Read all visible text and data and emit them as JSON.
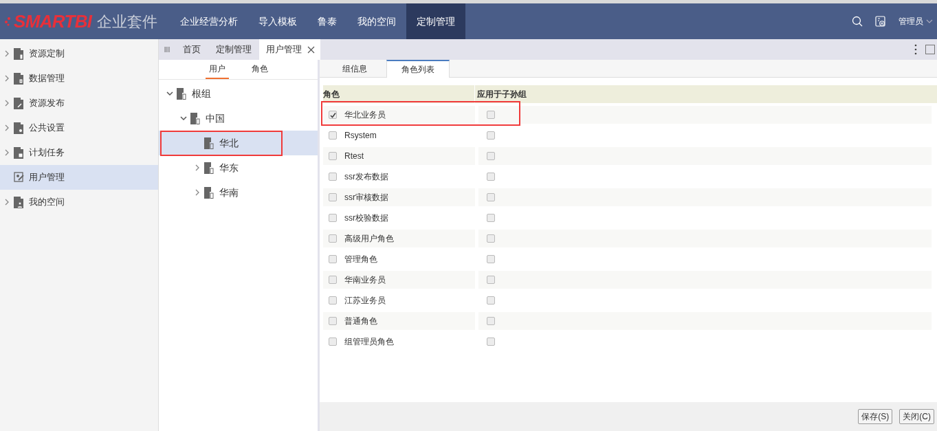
{
  "header": {
    "logo": "SMARTBI",
    "product": "企业套件",
    "nav": [
      {
        "label": "企业经营分析",
        "selected": false
      },
      {
        "label": "导入模板",
        "selected": false
      },
      {
        "label": "鲁泰",
        "selected": false
      },
      {
        "label": "我的空间",
        "selected": false
      },
      {
        "label": "定制管理",
        "selected": true
      }
    ],
    "user": "管理员"
  },
  "sidebar": {
    "items": [
      {
        "label": "资源定制",
        "selected": false,
        "expandable": true
      },
      {
        "label": "数据管理",
        "selected": false,
        "expandable": true
      },
      {
        "label": "资源发布",
        "selected": false,
        "expandable": true
      },
      {
        "label": "公共设置",
        "selected": false,
        "expandable": true
      },
      {
        "label": "计划任务",
        "selected": false,
        "expandable": true
      },
      {
        "label": "用户管理",
        "selected": true,
        "expandable": false
      },
      {
        "label": "我的空间",
        "selected": false,
        "expandable": true
      }
    ]
  },
  "tab_bar_handle": "III",
  "tabs": [
    {
      "label": "首页",
      "selected": false,
      "closable": false
    },
    {
      "label": "定制管理",
      "selected": false,
      "closable": false
    },
    {
      "label": "用户管理",
      "selected": true,
      "closable": true
    }
  ],
  "tree_tabs": [
    {
      "label": "用户",
      "selected": true
    },
    {
      "label": "角色",
      "selected": false
    }
  ],
  "tree": [
    {
      "label": "根组",
      "expanded": true,
      "selected": false,
      "highlighted": false,
      "children": [
        {
          "label": "中国",
          "expanded": true,
          "selected": false,
          "highlighted": false,
          "children": [
            {
              "label": "华北",
              "selected": true,
              "highlighted": true
            },
            {
              "label": "华东",
              "expanded": false,
              "selected": false,
              "highlighted": false
            },
            {
              "label": "华南",
              "expanded": false,
              "selected": false,
              "highlighted": false
            }
          ]
        }
      ]
    }
  ],
  "detail_tabs": [
    {
      "label": "组信息",
      "selected": false
    },
    {
      "label": "角色列表",
      "selected": true
    }
  ],
  "table": {
    "columns": [
      "角色",
      "应用于子孙组"
    ],
    "rows": [
      {
        "role": "华北业务员",
        "checked": true,
        "apply_to_descendants": false,
        "highlighted": true
      },
      {
        "role": "Rsystem",
        "checked": false,
        "apply_to_descendants": false,
        "highlighted": false
      },
      {
        "role": "Rtest",
        "checked": false,
        "apply_to_descendants": false,
        "highlighted": false
      },
      {
        "role": "ssr发布数据",
        "checked": false,
        "apply_to_descendants": false,
        "highlighted": false
      },
      {
        "role": "ssr审核数据",
        "checked": false,
        "apply_to_descendants": false,
        "highlighted": false
      },
      {
        "role": "ssr校验数据",
        "checked": false,
        "apply_to_descendants": false,
        "highlighted": false
      },
      {
        "role": "高级用户角色",
        "checked": false,
        "apply_to_descendants": false,
        "highlighted": false
      },
      {
        "role": "管理角色",
        "checked": false,
        "apply_to_descendants": false,
        "highlighted": false
      },
      {
        "role": "华南业务员",
        "checked": false,
        "apply_to_descendants": false,
        "highlighted": false
      },
      {
        "role": "江苏业务员",
        "checked": false,
        "apply_to_descendants": false,
        "highlighted": false
      },
      {
        "role": "普通角色",
        "checked": false,
        "apply_to_descendants": false,
        "highlighted": false
      },
      {
        "role": "组管理员角色",
        "checked": false,
        "apply_to_descendants": false,
        "highlighted": false
      }
    ]
  },
  "buttons": [
    "保存(S)",
    "关闭(C)"
  ]
}
